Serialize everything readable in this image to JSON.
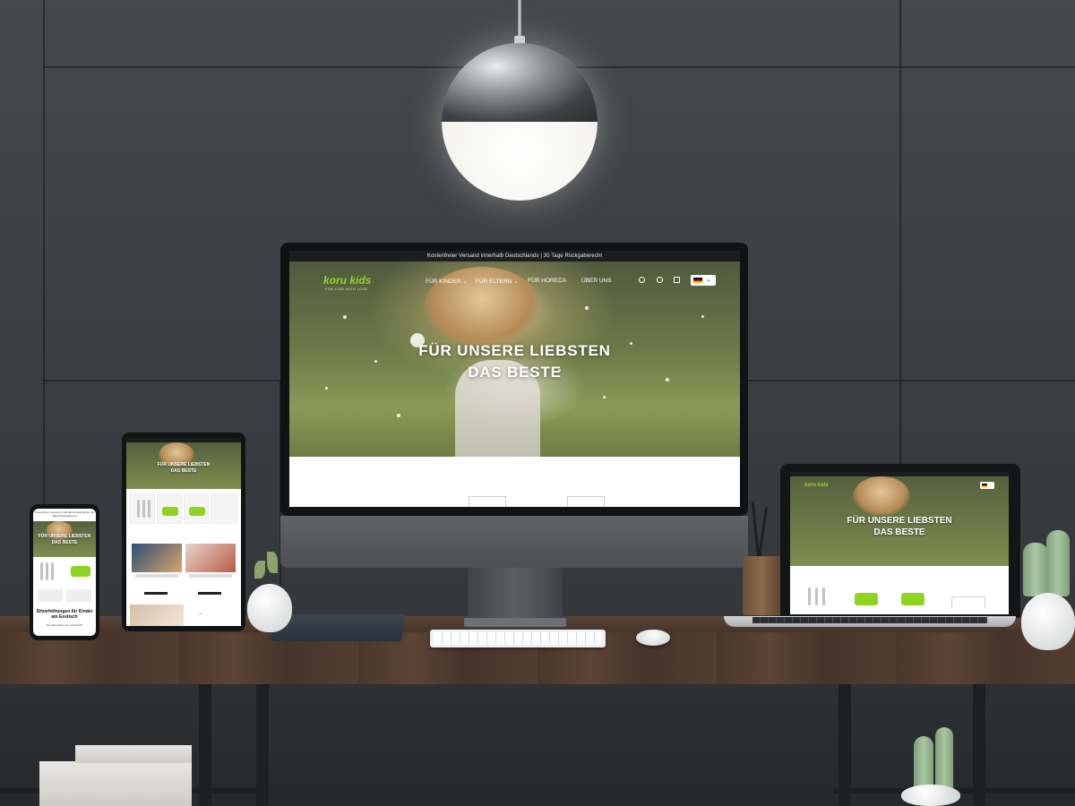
{
  "scene": "responsive-mockup",
  "site": {
    "announcement": "Kostenfreier Versand innerhalb Deutschlands | 30 Tage Rückgaberecht",
    "logo": {
      "text": "koru kids",
      "tagline": "FOR KIDS WITH LOVE"
    },
    "nav": [
      {
        "label": "FÜR KINDER",
        "has_dropdown": true
      },
      {
        "label": "FÜR ELTERN",
        "has_dropdown": true
      },
      {
        "label": "FÜR HORECA",
        "has_dropdown": false
      },
      {
        "label": "ÜBER UNS",
        "has_dropdown": false
      }
    ],
    "header_icons": [
      "search-icon",
      "account-icon",
      "cart-icon"
    ],
    "language": {
      "flag": "de-flag-icon",
      "chevron": "⌄"
    },
    "hero_title_line1": "FÜR UNSERE LIEBSTEN",
    "hero_title_line2": "DAS BESTE",
    "brand_color": "#9ad12b"
  },
  "tablet": {
    "hero_title": "FÜR UNSERE LIEBSTEN DAS BESTE",
    "dots": "• • •"
  },
  "phone": {
    "announcement": "Kostenfreier Versand innerhalb Deutschlands | 30 Tage Rückgaberecht",
    "hero_title_line1": "FÜR UNSERE LIEBSTEN",
    "hero_title_line2": "DAS BESTE",
    "section_heading": "Sitzerhöhungen für Kinder am Esstisch",
    "section_sub": "Die Alternative zum Hochstuhl"
  },
  "laptop": {
    "hero_title_line1": "FÜR UNSERE LIEBSTEN",
    "hero_title_line2": "DAS BESTE"
  }
}
